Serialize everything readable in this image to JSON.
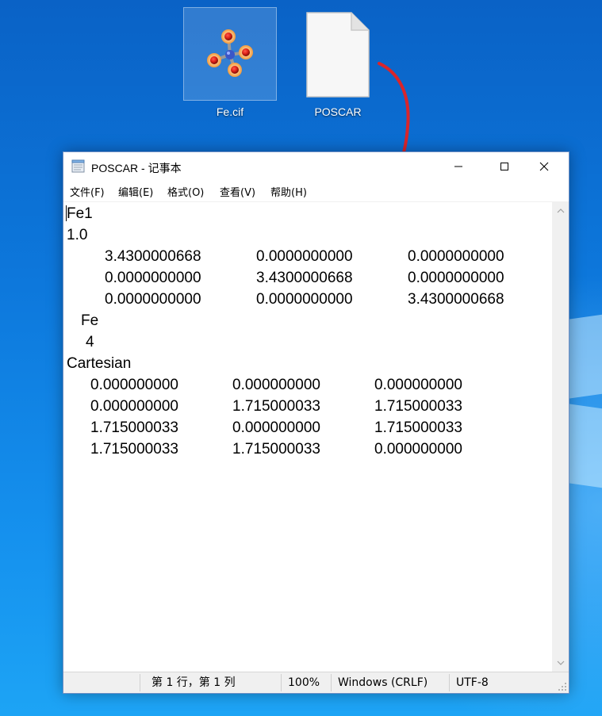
{
  "desktop": {
    "icons": [
      {
        "label": "Fe.cif",
        "icon": "molecule-file-icon",
        "selected": true
      },
      {
        "label": "POSCAR",
        "icon": "blank-document-icon",
        "selected": false
      }
    ],
    "annotation_color": "#d9252b"
  },
  "notepad": {
    "title": "POSCAR - 记事本",
    "menu": [
      "文件(F)",
      "编辑(E)",
      "格式(O)",
      "查看(V)",
      "帮助(H)"
    ],
    "lines": [
      "Fe1",
      "1.0",
      "3.4300000668",
      "0.0000000000",
      "0.0000000000",
      "0.0000000000",
      "3.4300000668",
      "0.0000000000",
      "0.0000000000",
      "0.0000000000",
      "3.4300000668",
      "Fe",
      "4",
      "Cartesian",
      "0.000000000",
      "0.000000000",
      "0.000000000",
      "0.000000000",
      "1.715000033",
      "1.715000033",
      "1.715000033",
      "0.000000000",
      "1.715000033",
      "1.715000033",
      "1.715000033",
      "0.000000000"
    ],
    "status": {
      "position": "第 1 行，第 1 列",
      "zoom": "100%",
      "line_ending": "Windows (CRLF)",
      "encoding": "UTF-8"
    }
  }
}
